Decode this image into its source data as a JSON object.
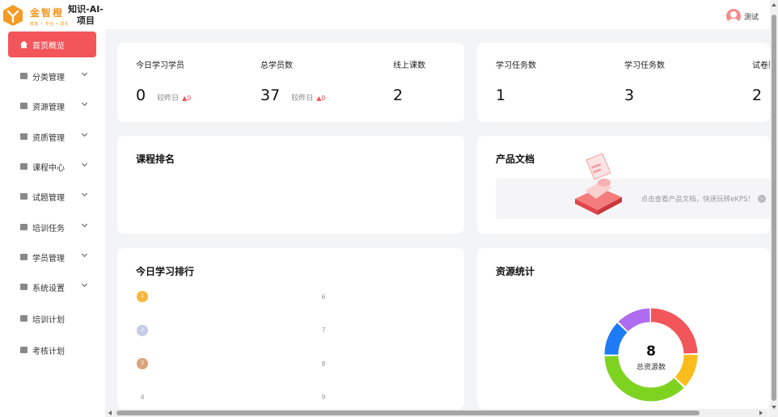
{
  "brand": {
    "name": "金智橙",
    "slogan": "赋能 • 专业 • 成长",
    "project_title": "知识-AI-项目",
    "accent": "#f59a23"
  },
  "user": {
    "name": "测试",
    "avatar_icon": "user-avatar-icon"
  },
  "sidebar": {
    "active_color": "#f2555a",
    "items": [
      {
        "label": "首页概览",
        "icon": "home-icon",
        "active": true,
        "expandable": false
      },
      {
        "label": "分类管理",
        "icon": "category-icon",
        "expandable": true
      },
      {
        "label": "资源管理",
        "icon": "folder-icon",
        "expandable": true
      },
      {
        "label": "资质管理",
        "icon": "certificate-icon",
        "expandable": true
      },
      {
        "label": "课程中心",
        "icon": "book-icon",
        "expandable": true
      },
      {
        "label": "试题管理",
        "icon": "question-icon",
        "expandable": true
      },
      {
        "label": "培训任务",
        "icon": "task-icon",
        "expandable": true
      },
      {
        "label": "学员管理",
        "icon": "student-icon",
        "expandable": true
      },
      {
        "label": "系统设置",
        "icon": "settings-icon",
        "expandable": true
      },
      {
        "label": "培训计划",
        "icon": "plan-icon",
        "expandable": false
      },
      {
        "label": "考核计划",
        "icon": "exam-icon",
        "expandable": false
      }
    ]
  },
  "stats_left": [
    {
      "label": "今日学习学员",
      "value": "0",
      "compare": "较昨日",
      "delta": "▲0"
    },
    {
      "label": "总学员数",
      "value": "37",
      "compare": "较昨日",
      "delta": "▲0"
    },
    {
      "label": "线上课数",
      "value": "2"
    }
  ],
  "stats_right": [
    {
      "label": "学习任务数",
      "value": "1"
    },
    {
      "label": "学习任务数",
      "value": "3"
    },
    {
      "label": "试卷数",
      "value": "2"
    }
  ],
  "course_ranking": {
    "title": "课程排名"
  },
  "product_docs": {
    "title": "产品文档",
    "link_text": "点击查看产品文档，快速玩转eKPS！",
    "arrow_icon": "chevron-right-circle-icon"
  },
  "today_ranking": {
    "title": "今日学习排行",
    "left": [
      {
        "rank": "1",
        "medal": "gold"
      },
      {
        "rank": "2",
        "medal": "silver"
      },
      {
        "rank": "3",
        "medal": "bronze"
      },
      {
        "rank": "4"
      }
    ],
    "right": [
      "6",
      "7",
      "8",
      "9"
    ]
  },
  "resource_stats": {
    "title": "资源统计",
    "total": "8",
    "total_label": "总资源数"
  },
  "chart_data": {
    "type": "pie",
    "title": "资源统计",
    "series": [
      {
        "value": 2,
        "color": "#f2555a"
      },
      {
        "value": 1,
        "color": "#fbbd1e"
      },
      {
        "value": 3,
        "color": "#7ed321"
      },
      {
        "value": 1,
        "color": "#1e7bf5"
      },
      {
        "value": 1,
        "color": "#b06cf0"
      }
    ],
    "center_value": "8",
    "center_label": "总资源数"
  }
}
